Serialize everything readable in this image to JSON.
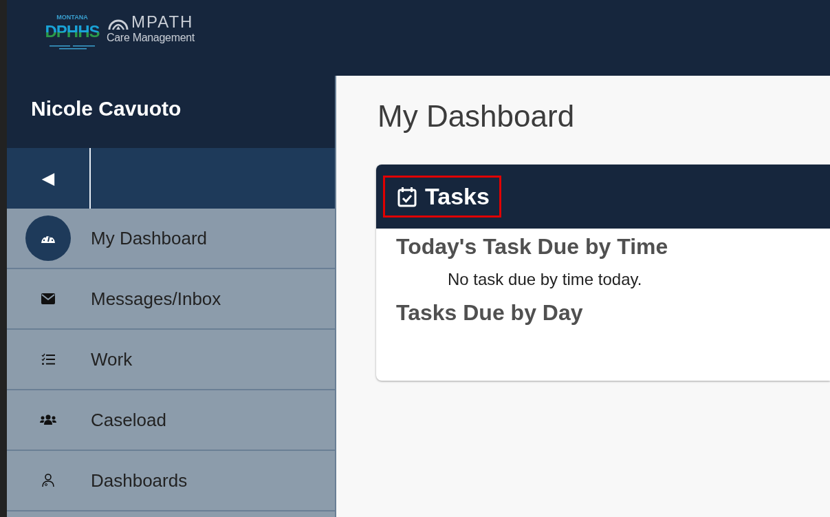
{
  "header": {
    "logo_state": "MONTANA",
    "logo_agency": "DPHHS",
    "logo_product": "MPATH",
    "logo_subtitle": "Care Management"
  },
  "sidebar": {
    "user_name": "Nicole Cavuoto",
    "collapse_icon": "◀",
    "items": [
      {
        "label": "My Dashboard",
        "kind": "gauge",
        "selected": true
      },
      {
        "label": "Messages/Inbox",
        "kind": "envelope",
        "selected": false
      },
      {
        "label": "Work",
        "kind": "checklist",
        "selected": false
      },
      {
        "label": "Caseload",
        "kind": "people",
        "selected": false
      },
      {
        "label": "Dashboards",
        "kind": "person",
        "selected": false
      }
    ]
  },
  "main": {
    "title": "My Dashboard",
    "card": {
      "title": "Tasks",
      "highlighted": true,
      "sections": [
        {
          "heading": "Today's Task Due by Time",
          "message": "No task due by time today."
        },
        {
          "heading": "Tasks Due by Day"
        }
      ]
    }
  }
}
